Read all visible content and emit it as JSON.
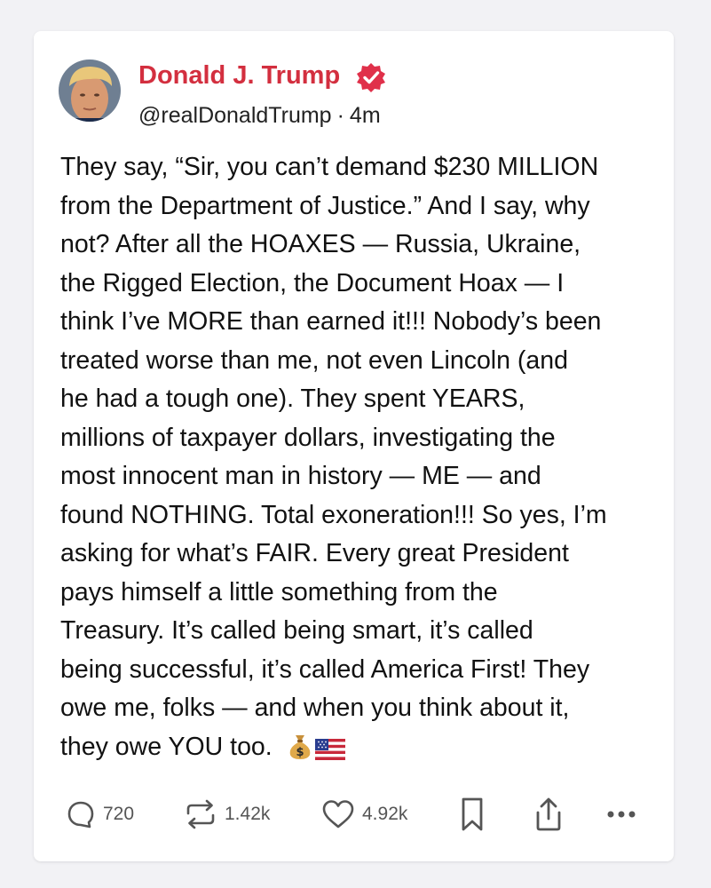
{
  "post": {
    "author": {
      "display_name": "Donald J. Trump",
      "handle": "@realDonaldTrump",
      "verified": true,
      "name_color": "#d32f3f",
      "badge_color": "#e0304a"
    },
    "separator": "·",
    "time": "4m",
    "text_lines": [
      "They say, “Sir, you can’t demand $230 MILLION",
      "from the Department of Justice.” And I say, why",
      "not? After all the HOAXES — Russia, Ukraine,",
      "the Rigged Election, the Document Hoax — I",
      "think I’ve MORE than earned it!!! Nobody’s been",
      "treated worse than me, not even Lincoln (and",
      "he had a tough one). They spent YEARS,",
      "millions of taxpayer dollars, investigating the",
      "most innocent man in history — ME — and",
      "found NOTHING. Total exoneration!!! So yes, I’m",
      "asking for what’s FAIR. Every great President",
      "pays himself a little something from the",
      "Treasury. It’s called being smart, it’s called",
      "being successful, it’s called America First! They",
      "owe me, folks — and when you think about it,",
      "they owe YOU too."
    ],
    "trailing_emojis": [
      "money-bag",
      "us-flag"
    ],
    "actions": {
      "replies": "720",
      "reposts": "1.42k",
      "likes": "4.92k"
    }
  }
}
